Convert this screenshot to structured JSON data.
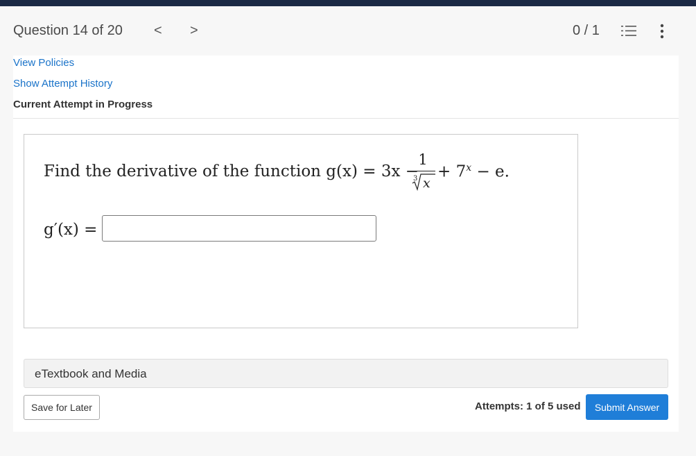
{
  "header": {
    "question_counter": "Question 14 of 20",
    "prev_symbol": "<",
    "next_symbol": ">",
    "score": "0 / 1"
  },
  "links": {
    "view_policies": "View Policies",
    "show_attempt_history": "Show Attempt History"
  },
  "attempt_status": "Current Attempt in Progress",
  "question": {
    "prompt_prefix": "Find the derivative of the function g(x) = 3x −",
    "fraction_numerator": "1",
    "radical_index": "3",
    "radical_variable": "x",
    "prompt_suffix_plus": "+ 7",
    "exponent": "x",
    "prompt_suffix_end": "− e.",
    "answer_label": "g′(x) =",
    "answer_value": ""
  },
  "media": {
    "label": "eTextbook and Media"
  },
  "footer": {
    "save_label": "Save for Later",
    "attempts_text": "Attempts: 1 of 5 used",
    "submit_label": "Submit Answer"
  },
  "colors": {
    "top_bar": "#1b2a45",
    "link": "#1a73c9",
    "submit": "#1f7ed8"
  },
  "icons": [
    "chevron-left-icon",
    "chevron-right-icon",
    "numbered-list-icon",
    "more-vertical-icon"
  ]
}
